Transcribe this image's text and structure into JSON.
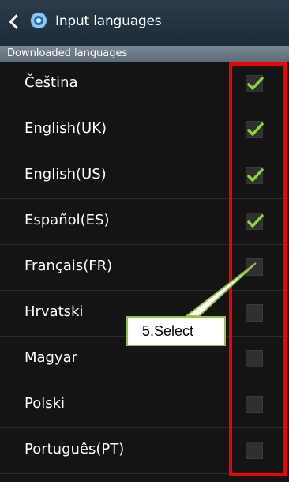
{
  "header": {
    "title": "Input languages"
  },
  "section": {
    "label": "Downloaded languages"
  },
  "languages": [
    {
      "label": "Čeština",
      "checked": true
    },
    {
      "label": "English(UK)",
      "checked": true
    },
    {
      "label": "English(US)",
      "checked": true
    },
    {
      "label": "Español(ES)",
      "checked": true
    },
    {
      "label": "Français(FR)",
      "checked": false
    },
    {
      "label": "Hrvatski",
      "checked": false
    },
    {
      "label": "Magyar",
      "checked": false
    },
    {
      "label": "Polski",
      "checked": false
    },
    {
      "label": "Português(PT)",
      "checked": false
    }
  ],
  "annotation": {
    "callout_text": "5.Select",
    "highlight_color": "#f20000",
    "callout_border_color": "#93c24d"
  },
  "colors": {
    "check_green": "#8bd63b",
    "header_bg": "#2a3c4c",
    "section_bg": "#6e7b88"
  }
}
